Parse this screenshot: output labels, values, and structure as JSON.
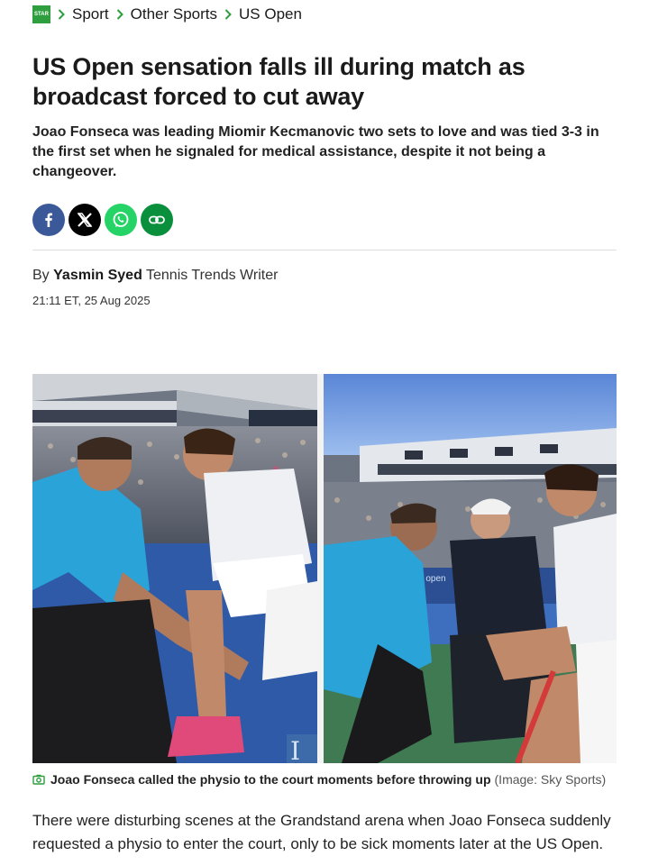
{
  "breadcrumb": {
    "logo_text": "STAR",
    "items": [
      "Sport",
      "Other Sports",
      "US Open"
    ]
  },
  "article": {
    "headline": "US Open sensation falls ill during match as broadcast forced to cut away",
    "standfirst": "Joao Fonseca was leading Miomir Kecmanovic two sets to love and was tied 3-3 in the first set when he signaled for medical assistance, despite it not being a changeover.",
    "byline_prefix": "By",
    "author": "Yasmin Syed",
    "author_role": "Tennis Trends Writer",
    "timestamp": "21:11 ET, 25 Aug 2025",
    "image_caption": "Joao Fonseca called the physio to the court moments before throwing up",
    "image_credit": "(Image: Sky Sports)",
    "body_paragraph": "There were disturbing scenes at the Grandstand arena when Joao Fonseca suddenly requested a physio to enter the court, only to be sick moments later at the US Open."
  },
  "share": {
    "buttons": [
      "facebook-icon",
      "x-icon",
      "whatsapp-icon",
      "link-icon"
    ]
  },
  "photo": {
    "court_sign": "us open"
  },
  "colors": {
    "brand_green": "#2e9e3f",
    "facebook": "#3b5998",
    "x": "#000000",
    "whatsapp": "#25d366",
    "link": "#0a8f3c"
  }
}
